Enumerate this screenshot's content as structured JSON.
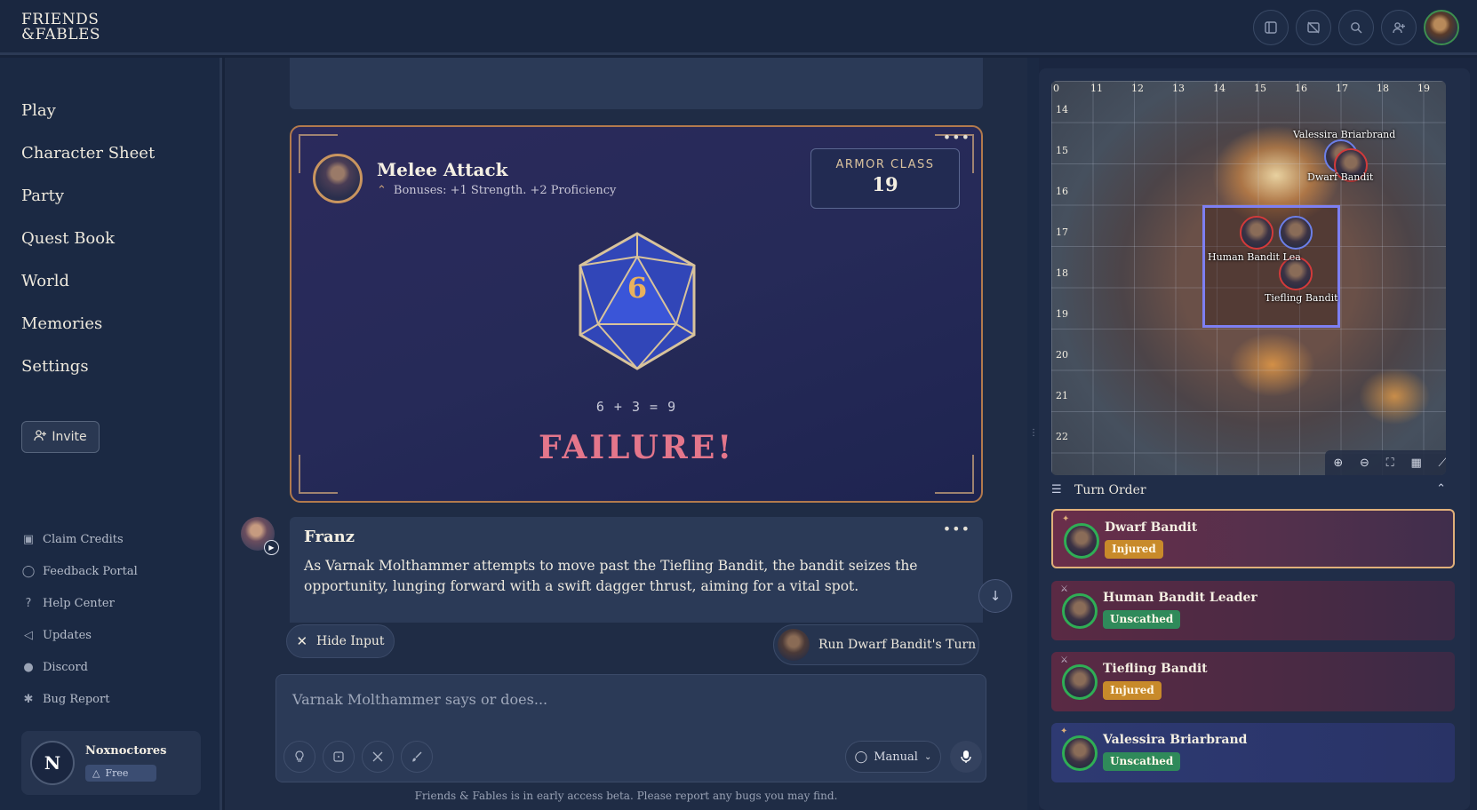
{
  "app": {
    "logo_line1": "FRIENDS",
    "logo_line2": "&FABLES"
  },
  "header": {
    "icons": [
      "sidebar-toggle-icon",
      "image-off-icon",
      "search-icon",
      "add-user-icon"
    ],
    "avatar": "profile-avatar"
  },
  "sidebar": {
    "nav": [
      {
        "label": "Play"
      },
      {
        "label": "Character Sheet"
      },
      {
        "label": "Party"
      },
      {
        "label": "Quest Book"
      },
      {
        "label": "World"
      },
      {
        "label": "Memories"
      },
      {
        "label": "Settings"
      }
    ],
    "invite_label": "Invite",
    "links": [
      {
        "label": "Claim Credits",
        "icon": "gift-icon"
      },
      {
        "label": "Feedback Portal",
        "icon": "chat-bubble-icon"
      },
      {
        "label": "Help Center",
        "icon": "question-circle-icon"
      },
      {
        "label": "Updates",
        "icon": "megaphone-icon"
      },
      {
        "label": "Discord",
        "icon": "discord-icon"
      },
      {
        "label": "Bug Report",
        "icon": "bug-icon"
      }
    ],
    "user": {
      "initial": "N",
      "name": "Noxnoctores",
      "plan": "Free"
    }
  },
  "roll": {
    "title": "Melee Attack",
    "bonuses": "Bonuses: +1 Strength. +2 Proficiency",
    "ac_label": "ARMOR CLASS",
    "ac_value": "19",
    "die_value": "6",
    "equation": "6 + 3 = 9",
    "result": "FAILURE!",
    "colors": {
      "border": "#b27a4d",
      "failure": "#e4768b",
      "die_number": "#e9b15d"
    }
  },
  "message": {
    "author": "Franz",
    "text": "As Varnak Molthammer attempts to move past the Tiefling Bandit, the bandit seizes the opportunity, lunging forward with a swift dagger thrust, aiming for a vital spot."
  },
  "controls": {
    "hide_input_label": "Hide Input",
    "run_turn_label": "Run Dwarf Bandit's Turn",
    "input_placeholder": "Varnak Molthammer says or does...",
    "mode_value": "Manual",
    "tool_icons": [
      "lightbulb-icon",
      "dice-icon",
      "crossed-swords-icon",
      "paintbrush-icon"
    ],
    "beta_note": "Friends & Fables is in early access beta. Please report any bugs you may find."
  },
  "map": {
    "columns": [
      "0",
      "11",
      "12",
      "13",
      "14",
      "15",
      "16",
      "17",
      "18",
      "19"
    ],
    "rows": [
      "14",
      "15",
      "16",
      "17",
      "18",
      "19",
      "20",
      "21",
      "22"
    ],
    "labels": {
      "valessira": "Valessira Briarbrand",
      "dwarf": "Dwarf Bandit",
      "human": "Human Bandit Lea",
      "tiefling": "Tiefling Bandit"
    },
    "tools": [
      "zoom-in-icon",
      "zoom-out-icon",
      "fit-screen-icon",
      "grid-icon",
      "ruler-icon"
    ]
  },
  "turn_order": {
    "title": "Turn Order",
    "entries": [
      {
        "name": "Dwarf Bandit",
        "status": "Injured"
      },
      {
        "name": "Human Bandit Leader",
        "status": "Unscathed"
      },
      {
        "name": "Tiefling Bandit",
        "status": "Injured"
      },
      {
        "name": "Valessira Briarbrand",
        "status": "Unscathed"
      }
    ]
  }
}
